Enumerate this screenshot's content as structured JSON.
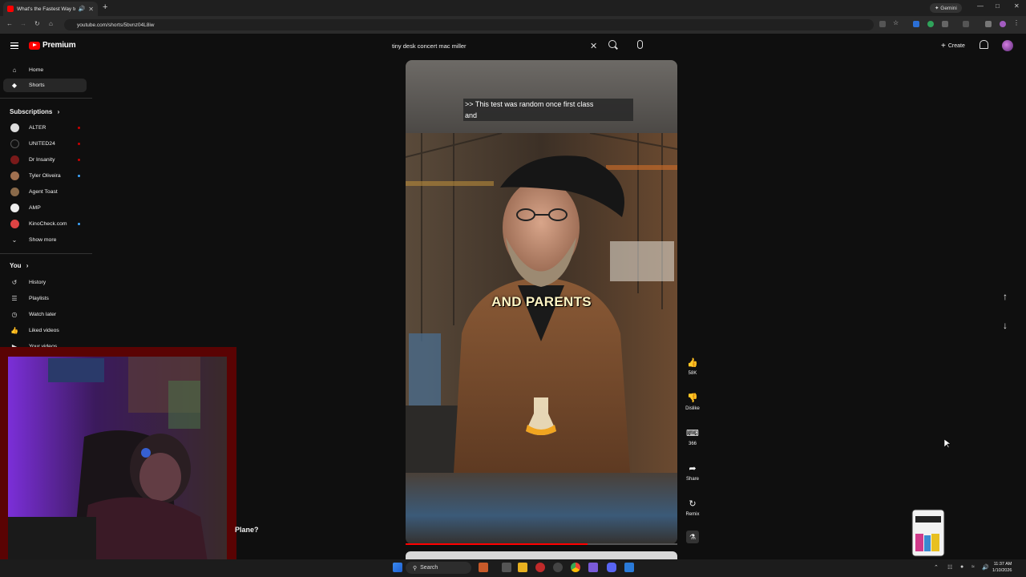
{
  "browser": {
    "tab_title": "What's the Fastest Way to B",
    "url": "youtube.com/shorts/5bvnz04L8iw",
    "gemini_label": "Gemini"
  },
  "header": {
    "brand": "Premium",
    "search_value": "tiny desk concert mac miller",
    "create_label": "Create"
  },
  "sidebar": {
    "home": "Home",
    "shorts": "Shorts",
    "subscriptions_title": "Subscriptions",
    "subscriptions": [
      {
        "name": "ALTER",
        "dot": "#cc0000"
      },
      {
        "name": "UNITED24",
        "dot": "#cc0000"
      },
      {
        "name": "Dr Insanity",
        "dot": "#cc0000"
      },
      {
        "name": "Tyler Oliveira",
        "dot": "#3ea6ff"
      },
      {
        "name": "Agent Toast",
        "dot": ""
      },
      {
        "name": "AMP",
        "dot": ""
      },
      {
        "name": "KinoCheck.com",
        "dot": "#3ea6ff"
      }
    ],
    "show_more": "Show more",
    "you_title": "You",
    "you_items": [
      "History",
      "Playlists",
      "Watch later",
      "Liked videos",
      "Your videos"
    ]
  },
  "short": {
    "caption_line1": ">> This test was random once first class",
    "caption_line2": "and",
    "overlay_caption": "AND PARENTS",
    "progress": 0.67
  },
  "actions": {
    "likes": "58K",
    "dislike": "Dislike",
    "comments": "366",
    "share": "Share",
    "remix": "Remix"
  },
  "behind_text": "Plane?",
  "taskbar": {
    "search_label": "Search",
    "time": "11:37 AM",
    "date": "1/10/2026"
  },
  "colors": {
    "accent": "#ff0000",
    "background": "#0f0f0f",
    "webcam_border": "#5a0303"
  }
}
